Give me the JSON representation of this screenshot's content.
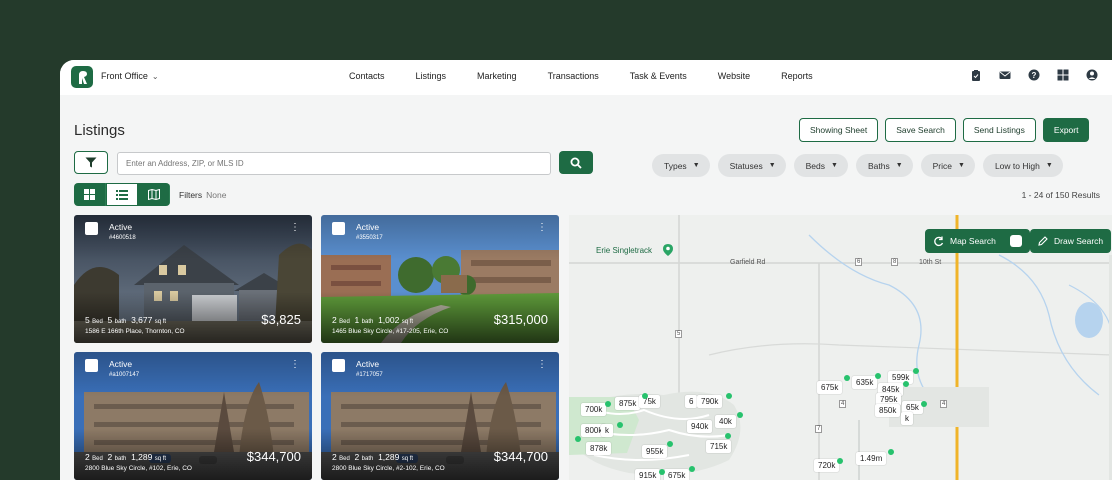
{
  "topbar": {
    "brand": "Front Office",
    "nav": [
      "Contacts",
      "Listings",
      "Marketing",
      "Transactions",
      "Task & Events",
      "Website",
      "Reports"
    ],
    "icons": [
      "clipboard-icon",
      "mail-icon",
      "help-icon",
      "apps-grid-icon",
      "account-icon"
    ]
  },
  "page": {
    "title": "Listings"
  },
  "actions": {
    "showing_sheet": "Showing Sheet",
    "save_search": "Save Search",
    "send_listings": "Send Listings",
    "export": "Export"
  },
  "search": {
    "placeholder": "Enter an Address, ZIP, or MLS ID"
  },
  "dropdowns": [
    "Types",
    "Statuses",
    "Beds",
    "Baths",
    "Price",
    "Low to High"
  ],
  "filters": {
    "label": "Filters",
    "value": "None"
  },
  "results": "1 - 24 of 150 Results",
  "listings": [
    {
      "status": "Active",
      "mls": "#4600518",
      "beds": "5",
      "beds_unit": "Bed",
      "baths": "5",
      "baths_unit": "bath",
      "sqft": "3,677",
      "sqft_unit": "sq ft",
      "address": "1586 E 166th Place, Thornton, CO",
      "price": "$3,825"
    },
    {
      "status": "Active",
      "mls": "#3550317",
      "beds": "2",
      "beds_unit": "Bed",
      "baths": "1",
      "baths_unit": "bath",
      "sqft": "1,002",
      "sqft_unit": "sq ft",
      "address": "1465 Blue Sky Circle, #17-205, Erie, CO",
      "price": "$315,000"
    },
    {
      "status": "Active",
      "mls": "#a1007147",
      "beds": "2",
      "beds_unit": "Bed",
      "baths": "2",
      "baths_unit": "bath",
      "sqft": "1,289",
      "sqft_unit": "sq ft",
      "address": "2800 Blue Sky Circle, #102, Erie, CO",
      "price": "$344,700"
    },
    {
      "status": "Active",
      "mls": "#1717057",
      "beds": "2",
      "beds_unit": "Bed",
      "baths": "2",
      "baths_unit": "bath",
      "sqft": "1,289",
      "sqft_unit": "sq ft",
      "address": "2800 Blue Sky Circle, #2-102, Erie, CO",
      "price": "$344,700"
    }
  ],
  "map": {
    "map_search": "Map Search",
    "draw_search": "Draw Search",
    "poi": "Erie Singletrack",
    "roads": [
      "Garfield Rd",
      "10th St"
    ],
    "route_shields": [
      "6",
      "8",
      "5",
      "7",
      "4",
      "4"
    ],
    "pins": [
      "700k",
      "875k",
      "75k",
      "6",
      "790k",
      "800k",
      "940k",
      "40k",
      "878k",
      "k",
      "955k",
      "715k",
      "675k",
      "635k",
      "599k",
      "845k",
      "795k",
      "850k",
      "65k",
      "k",
      "720k",
      "1.49m",
      "915k",
      "675k"
    ]
  },
  "colors": {
    "brand_green": "#1e6b44",
    "page_bg": "#243a2b",
    "pin_dot": "#27c26d",
    "highway": "#f0b429"
  }
}
